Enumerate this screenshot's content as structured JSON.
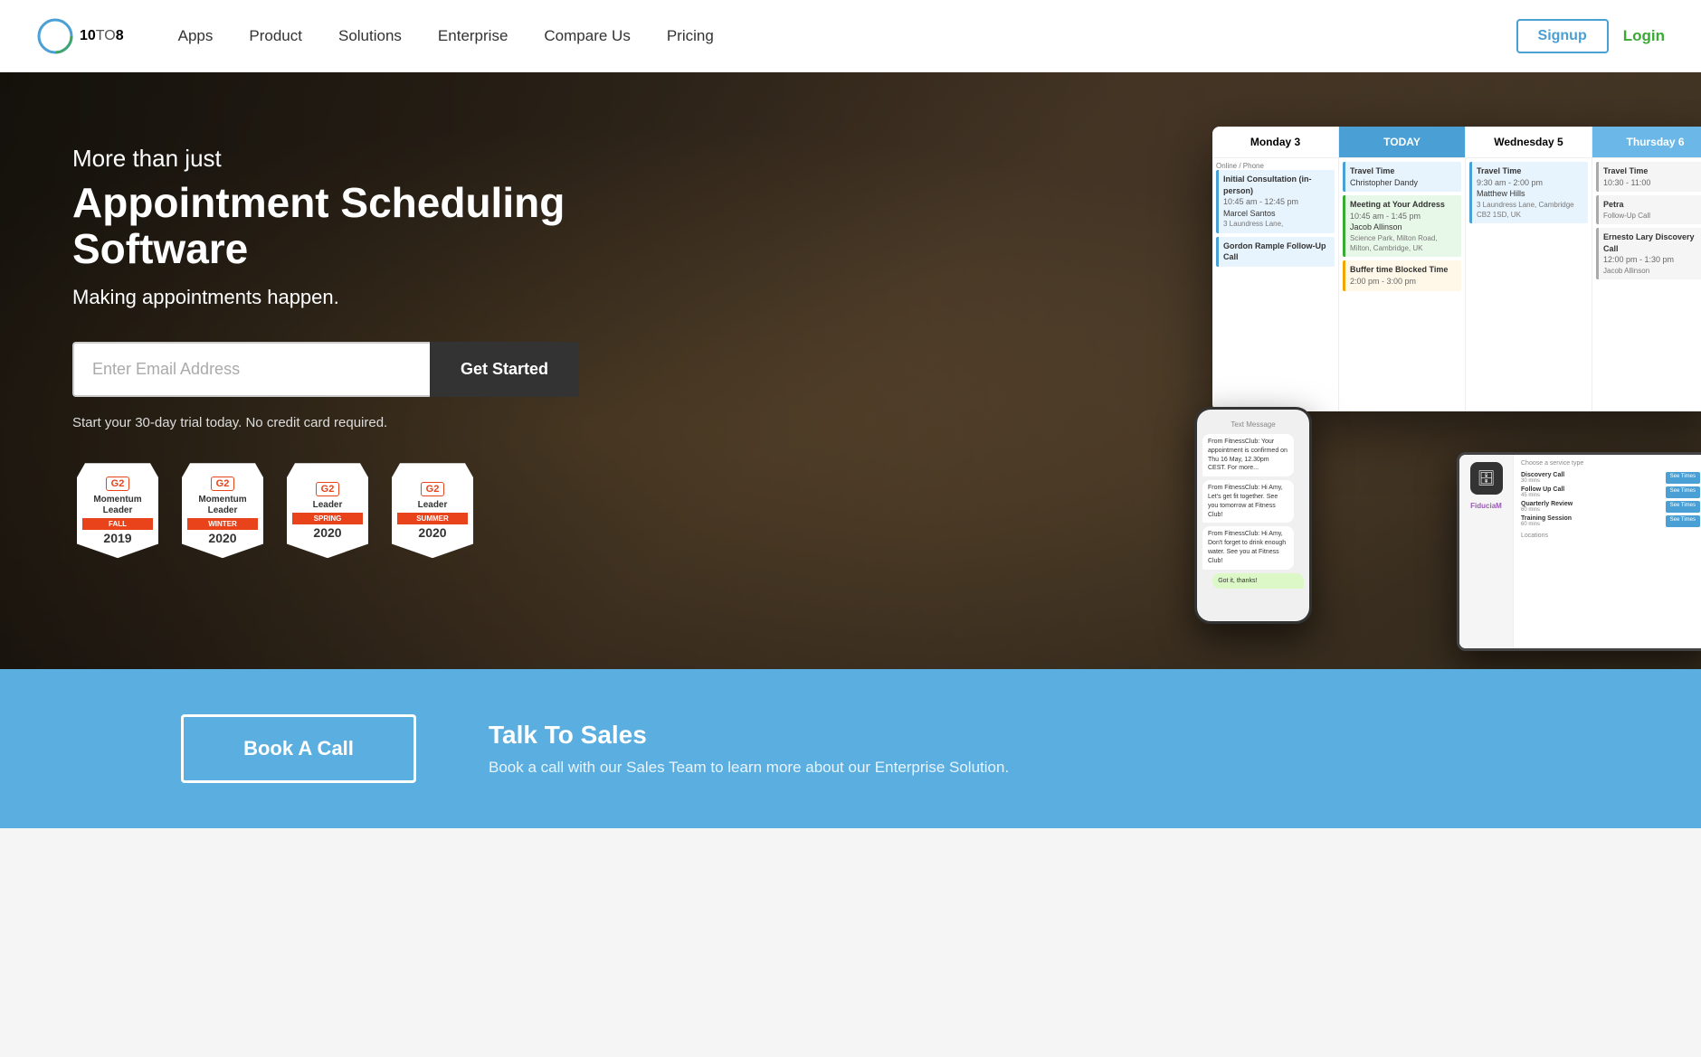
{
  "nav": {
    "logo_text": "10TO8",
    "links": [
      {
        "label": "Apps",
        "id": "apps"
      },
      {
        "label": "Product",
        "id": "product"
      },
      {
        "label": "Solutions",
        "id": "solutions"
      },
      {
        "label": "Enterprise",
        "id": "enterprise"
      },
      {
        "label": "Compare Us",
        "id": "compare"
      },
      {
        "label": "Pricing",
        "id": "pricing"
      }
    ],
    "signup_label": "Signup",
    "login_label": "Login"
  },
  "hero": {
    "subtitle": "More than just",
    "title": "Appointment Scheduling Software",
    "description": "Making appointments happen.",
    "email_placeholder": "Enter Email Address",
    "cta_button": "Get Started",
    "trial_text": "Start your 30-day trial today. No credit card required."
  },
  "badges": [
    {
      "g2": "G2",
      "title": "Momentum Leader",
      "banner": "FALL",
      "year": "2019"
    },
    {
      "g2": "G2",
      "title": "Momentum Leader",
      "banner": "WINTER",
      "year": "2020"
    },
    {
      "g2": "G2",
      "title": "Leader",
      "banner": "SPRING",
      "year": "2020"
    },
    {
      "g2": "G2",
      "title": "Leader",
      "banner": "SUMMER",
      "year": "2020"
    }
  ],
  "calendar": {
    "headers": [
      "Monday 3",
      "TODAY",
      "Wednesday 5",
      "Thursday 6"
    ],
    "events": {
      "monday": [
        {
          "type": "blue",
          "title": "Initial Consultation (in-person)",
          "time": "10:45 am - 12:45 pm",
          "person": "Marcel Santos",
          "address": "3 Laundress Lane,"
        },
        {
          "type": "blue",
          "title": "Gordon Rample Follow-Up Call",
          "time": "",
          "person": "",
          "address": ""
        }
      ],
      "today": [
        {
          "type": "blue",
          "title": "Travel Time",
          "time": "",
          "person": "Christopher Dandy",
          "address": ""
        },
        {
          "type": "green",
          "title": "Meeting at Your Address",
          "time": "10:45 am - 1:45 pm",
          "person": "Jacob Allinson",
          "address": "Science Park, Milton Road, Milton, Cambridge, UK"
        },
        {
          "type": "orange",
          "title": "Buffer time Blocked Time",
          "time": "2:00 pm - 3:00 pm",
          "person": "",
          "address": ""
        }
      ],
      "wednesday": [
        {
          "type": "blue",
          "title": "Travel Time",
          "time": "9:30 am - 2:00 pm",
          "person": "Matthew Hills",
          "address": "3 Laundress Lane, Cambridge CB2 1SD, UK"
        }
      ],
      "thursday": [
        {
          "type": "gray",
          "title": "Travel Time",
          "time": "10:30 - 11:00",
          "person": "",
          "address": ""
        },
        {
          "type": "gray",
          "title": "Petra Follow-Up Call",
          "time": "",
          "person": "",
          "address": ""
        },
        {
          "type": "gray",
          "title": "Ernesto Lary Discovery Call",
          "time": "12:00 pm - 1:30 pm",
          "person": "Jacob Allinson",
          "address": ""
        }
      ]
    }
  },
  "cta": {
    "button_label": "Book A Call",
    "title": "Talk To Sales",
    "description": "Book a call with our Sales Team to learn more about our Enterprise Solution."
  },
  "tablet": {
    "brand": "FiduciaM",
    "services": [
      {
        "label": "Discovery Call",
        "mins": "30 mins"
      },
      {
        "label": "Follow Up Call",
        "mins": "45 mins"
      },
      {
        "label": "Quarterly Review",
        "mins": "60 mins"
      },
      {
        "label": "Training Session",
        "mins": "60 mins"
      }
    ]
  },
  "phone": {
    "messages": [
      {
        "text": "From FitnessClub: Your appointment is confirmed on Thu 16 May, 12.30pm CEST.",
        "sent": false
      },
      {
        "text": "From FitnessClub: Hi Amy, Let's get fit together. See you tomorrow at Fitness Club!",
        "sent": false
      },
      {
        "text": "From FitnessClub: Hi Amy, Don't forget to drink enough water. See you at Fitness Club!",
        "sent": false
      },
      {
        "text": "Got it, thanks!",
        "sent": true
      }
    ]
  }
}
